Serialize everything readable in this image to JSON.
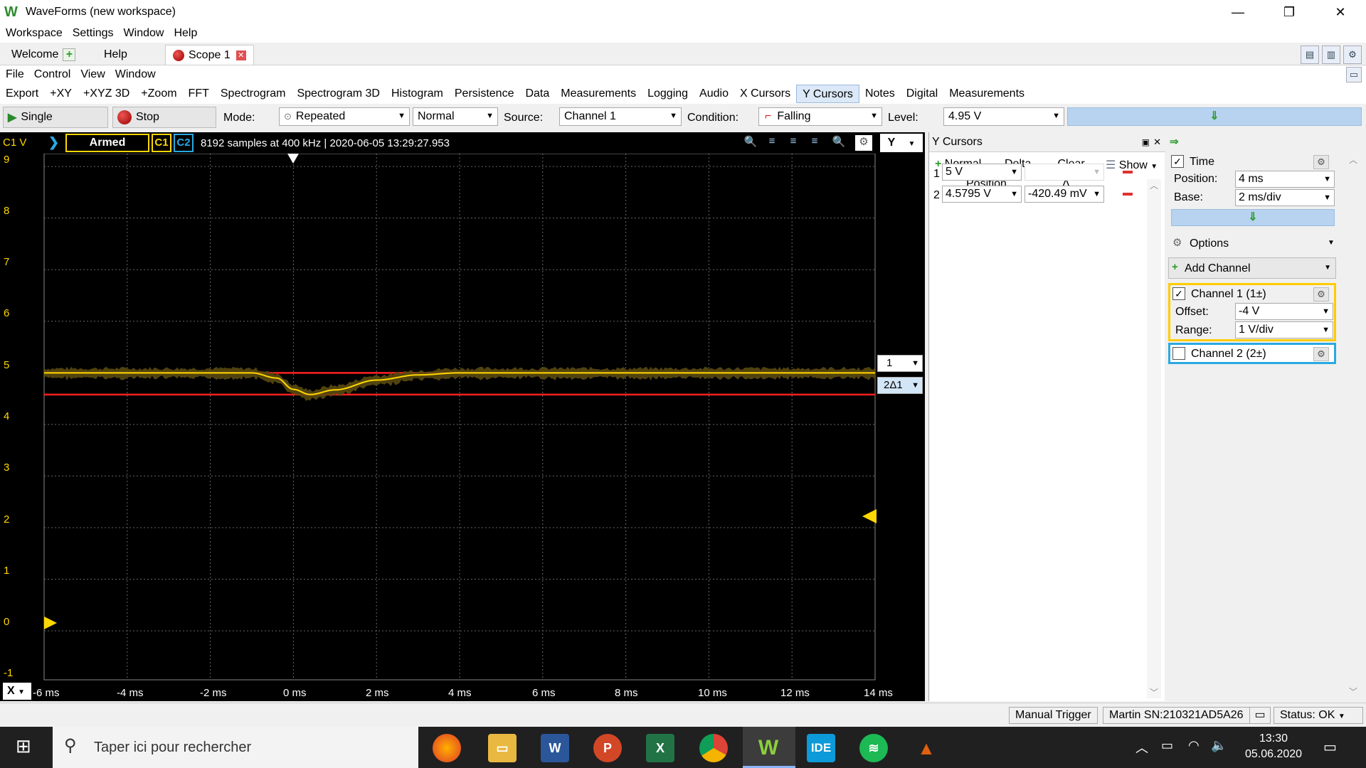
{
  "window": {
    "title": "WaveForms (new workspace)",
    "minimize": "—",
    "maximize": "❐",
    "close": "✕"
  },
  "main_menu": [
    "Workspace",
    "Settings",
    "Window",
    "Help"
  ],
  "tabs": {
    "welcome": "Welcome",
    "help": "Help",
    "scope": "Scope 1"
  },
  "scope_menu": [
    "File",
    "Control",
    "View",
    "Window"
  ],
  "tools": [
    "Export",
    "+XY",
    "+XYZ 3D",
    "+Zoom",
    "FFT",
    "Spectrogram",
    "Spectrogram 3D",
    "Histogram",
    "Persistence",
    "Data",
    "Measurements",
    "Logging",
    "Audio",
    "X Cursors",
    "Y Cursors",
    "Notes",
    "Digital",
    "Measurements"
  ],
  "tools_selected": "Y Cursors",
  "controls": {
    "single": "Single",
    "stop": "Stop",
    "mode_label": "Mode:",
    "mode_value": "Repeated",
    "mode2_value": "Normal",
    "source_label": "Source:",
    "source_value": "Channel 1",
    "condition_label": "Condition:",
    "condition_value": "Falling",
    "level_label": "Level:",
    "level_value": "4.95 V"
  },
  "scope": {
    "channel_unit": "C1 V",
    "status": "Armed",
    "c1": "C1",
    "c2": "C2",
    "info": "8192 samples at 400 kHz | 2020-06-05 13:29:27.953",
    "y_button": "Y",
    "x_button": "X",
    "y_ticks": [
      "9",
      "8",
      "7",
      "6",
      "5",
      "4",
      "3",
      "2",
      "1",
      "0",
      "-1"
    ],
    "x_ticks": [
      "-6 ms",
      "-4 ms",
      "-2 ms",
      "0 ms",
      "2 ms",
      "4 ms",
      "6 ms",
      "8 ms",
      "10 ms",
      "12 ms",
      "14 ms"
    ],
    "cursor1_tag": "1",
    "cursor2_tag": "2Δ1",
    "trace_color": "#ffd700",
    "cursor_color": "#ff2020"
  },
  "chart_data": {
    "type": "line",
    "xlabel": "",
    "ylabel": "C1 V",
    "xlim": [
      -6,
      14
    ],
    "ylim": [
      -1,
      10
    ],
    "series": [
      {
        "x": [
          -6,
          -1,
          -0.4,
          0,
          0.4,
          1,
          2,
          3,
          4,
          14
        ],
        "values": [
          5,
          5,
          4.9,
          4.68,
          4.58,
          4.67,
          4.86,
          4.96,
          5,
          5
        ]
      }
    ],
    "cursors": [
      5,
      4.5795
    ]
  },
  "ycursors": {
    "title": "Y Cursors",
    "normal": "Normal",
    "delta": "Delta",
    "clear": "Clear",
    "show": "Show",
    "col_position": "Position",
    "col_delta": "Δ",
    "rows": [
      {
        "num": "1",
        "position": "5 V",
        "delta": ""
      },
      {
        "num": "2",
        "position": "4.5795 V",
        "delta": "-420.49 mV"
      }
    ]
  },
  "right_panel": {
    "time_label": "Time",
    "position_label": "Position:",
    "position_value": "4 ms",
    "base_label": "Base:",
    "base_value": "2 ms/div",
    "options_label": "Options",
    "add_channel": "Add Channel",
    "ch1_label": "Channel 1 (1±)",
    "offset_label": "Offset:",
    "offset_value": "-4 V",
    "range_label": "Range:",
    "range_value": "1 V/div",
    "ch2_label": "Channel 2 (2±)",
    "ch1_color": "#ffcc00",
    "ch2_color": "#29a9e1"
  },
  "statusbar": {
    "manual_trigger": "Manual Trigger",
    "device": "Martin SN:210321AD5A26",
    "status": "Status: OK"
  },
  "taskbar": {
    "search_placeholder": "Taper ici pour rechercher",
    "time": "13:30",
    "date": "05.06.2020"
  }
}
